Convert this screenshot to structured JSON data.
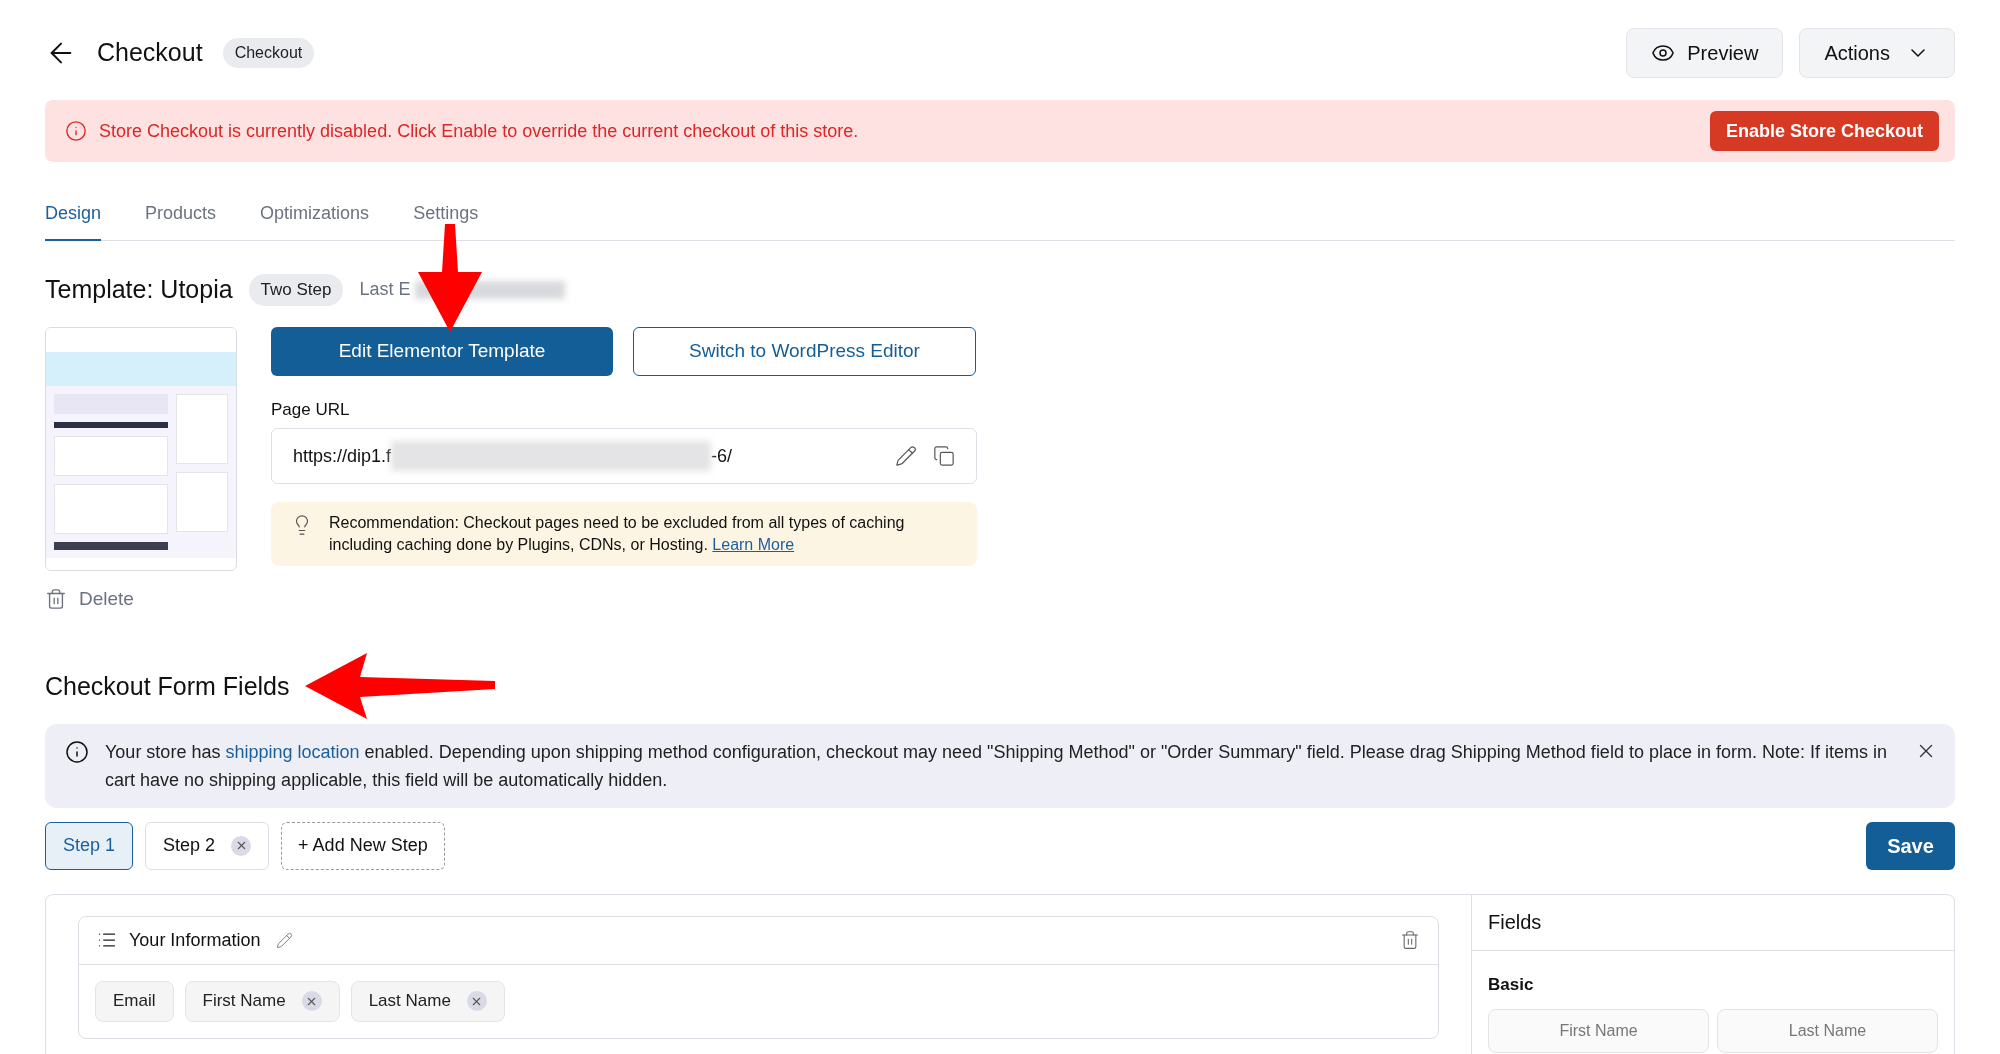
{
  "header": {
    "title": "Checkout",
    "badge": "Checkout",
    "buttons": [
      {
        "kind": "preview",
        "label": "Preview"
      },
      {
        "kind": "dropdown",
        "label": "Actions"
      }
    ]
  },
  "alert": {
    "message": "Store Checkout is currently disabled. Click Enable to override the current checkout of this store.",
    "button": "Enable Store Checkout"
  },
  "tabs": [
    {
      "label": "Design",
      "selected": true
    },
    {
      "label": "Products",
      "selected": false
    },
    {
      "label": "Optimizations",
      "selected": false
    },
    {
      "label": "Settings",
      "selected": false
    }
  ],
  "template": {
    "title": "Template: Utopia",
    "badge": "Two Step",
    "updated": "Last E",
    "primary_button": "Edit Elementor Template",
    "secondary_button": "Switch to WordPress Editor",
    "url_label": "Page URL",
    "url_start": "https://dip1.f",
    "url_end": "-6/",
    "recommendation": "Recommendation: Checkout pages need to be excluded from all types of caching including caching done by Plugins, CDNs, or Hosting.",
    "learn_more": "Learn More",
    "delete": "Delete"
  },
  "form_fields": {
    "title": "Checkout Form Fields",
    "notice_start": "Your store has",
    "notice_link": "shipping location",
    "notice_end": "enabled. Depending upon shipping method configuration, checkout may need \"Shipping Method\" or \"Order Summary\" field. Please drag Shipping Method field to place in form. Note: If items in cart have no shipping applicable, this field will be automatically hidden.",
    "steps": [
      {
        "label": "Step 1",
        "selected": true,
        "removable": false
      },
      {
        "label": "Step 2",
        "selected": false,
        "removable": true
      }
    ],
    "add_step": "+ Add New Step",
    "save": "Save",
    "section": {
      "title": "Your Information",
      "fields": [
        {
          "label": "Email",
          "removable": false
        },
        {
          "label": "First Name",
          "removable": true
        },
        {
          "label": "Last Name",
          "removable": true
        }
      ]
    },
    "panel": {
      "title": "Fields",
      "group": "Basic",
      "items": [
        "First Name",
        "Last Name"
      ]
    }
  }
}
